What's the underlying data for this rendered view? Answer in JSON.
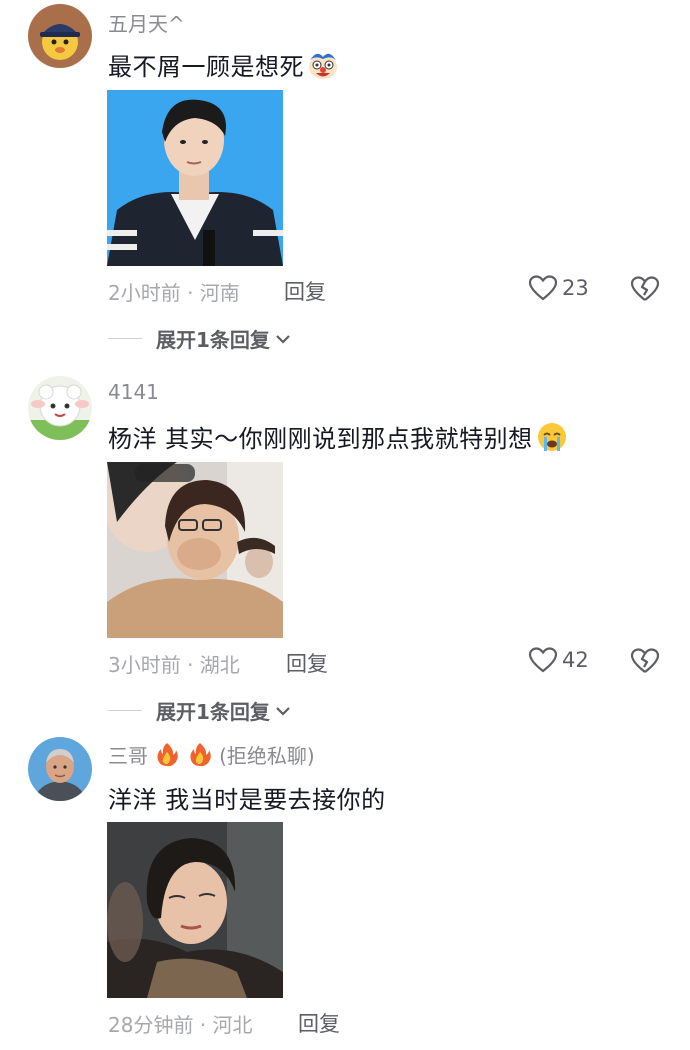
{
  "comments": [
    {
      "username": "五月天^",
      "text": "最不屑一顾是想死",
      "emoji": "grinning-clown-emoji",
      "time_location": "2小时前 · 河南",
      "reply_label": "回复",
      "likes": "23",
      "expand_label": "展开1条回复"
    },
    {
      "username": "4141",
      "text": "杨洋 其实～你刚刚说到那点我就特别想",
      "emoji": "crying-face-emoji",
      "time_location": "3小时前 · 湖北",
      "reply_label": "回复",
      "likes": "42",
      "expand_label": "展开1条回复"
    },
    {
      "username": "三哥",
      "username_suffix": "(拒绝私聊)",
      "text": "洋洋 我当时是要去接你的",
      "time_location": "28分钟前 · 河北",
      "reply_label": "回复"
    }
  ],
  "colors": {
    "text_primary": "#161823",
    "text_secondary": "#8a8b91",
    "text_meta": "#a7a8ad",
    "action": "#5d5e64"
  }
}
